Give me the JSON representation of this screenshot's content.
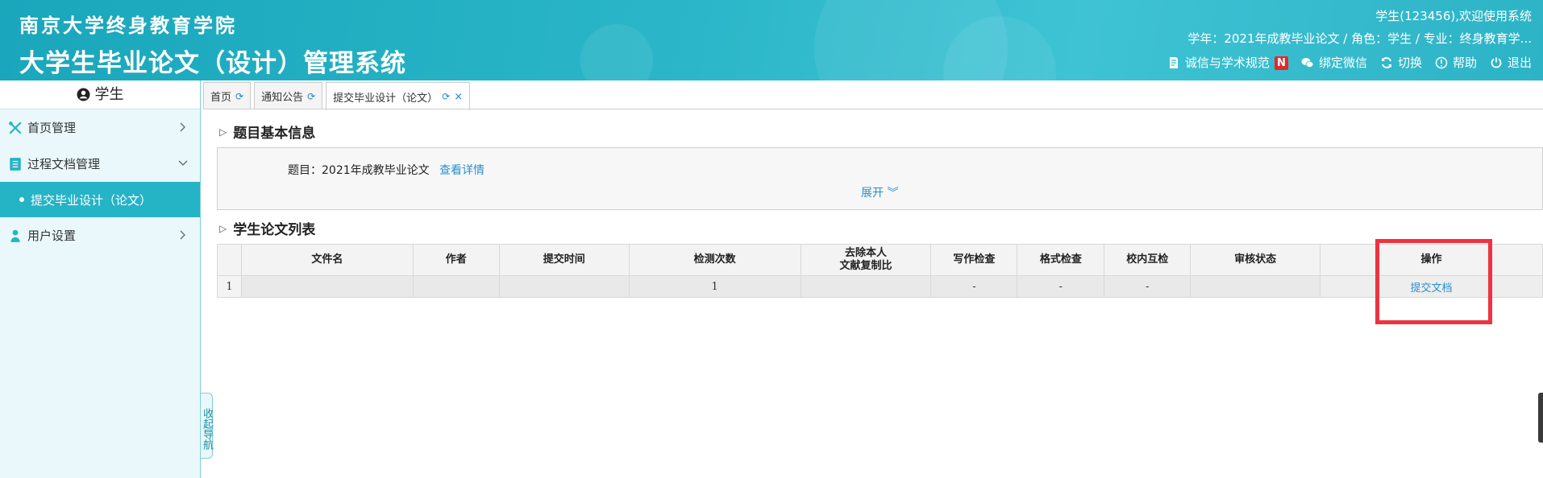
{
  "header": {
    "school_name": "南京大学终身教育学院",
    "system_name": "大学生毕业论文（设计）管理系统",
    "welcome": "学生(123456),欢迎使用系统",
    "context": "学年：2021年成教毕业论文 / 角色：学生 / 专业：终身教育学...",
    "links": {
      "integrity": "诚信与学术规范",
      "integrity_badge": "N",
      "wechat": "绑定微信",
      "switch": "切换",
      "help": "帮助",
      "logout": "退出"
    }
  },
  "sidebar": {
    "title": "学生",
    "items": [
      {
        "label": "首页管理"
      },
      {
        "label": "过程文档管理"
      },
      {
        "label": "提交毕业设计（论文）"
      },
      {
        "label": "用户设置"
      }
    ],
    "collapse_label": "收起导航"
  },
  "tabs": [
    {
      "label": "首页"
    },
    {
      "label": "通知公告"
    },
    {
      "label": "提交毕业设计（论文）"
    }
  ],
  "topic_section": {
    "title": "题目基本信息",
    "topic_label": "题目：",
    "topic_value": "2021年成教毕业论文",
    "detail_link": "查看详情",
    "expand_label": "展开"
  },
  "paper_section": {
    "title": "学生论文列表",
    "columns": [
      "文件名",
      "作者",
      "提交时间",
      "检测次数",
      "去除本人",
      "文献复制比",
      "写作检查",
      "格式检查",
      "校内互检",
      "审核状态",
      "操作"
    ],
    "rows": [
      {
        "index": "1",
        "file": "",
        "author": "",
        "time": "",
        "count": "1",
        "ratio": "",
        "writing": "-",
        "format": "-",
        "mutual": "-",
        "status": "",
        "action": "提交文档"
      }
    ]
  },
  "colors": {
    "header_start": "#1aa6bb",
    "header_end": "#3ec3d4",
    "sidebar_active": "#25b3c6",
    "link": "#2a8fce",
    "highlight": "#ee3340"
  }
}
